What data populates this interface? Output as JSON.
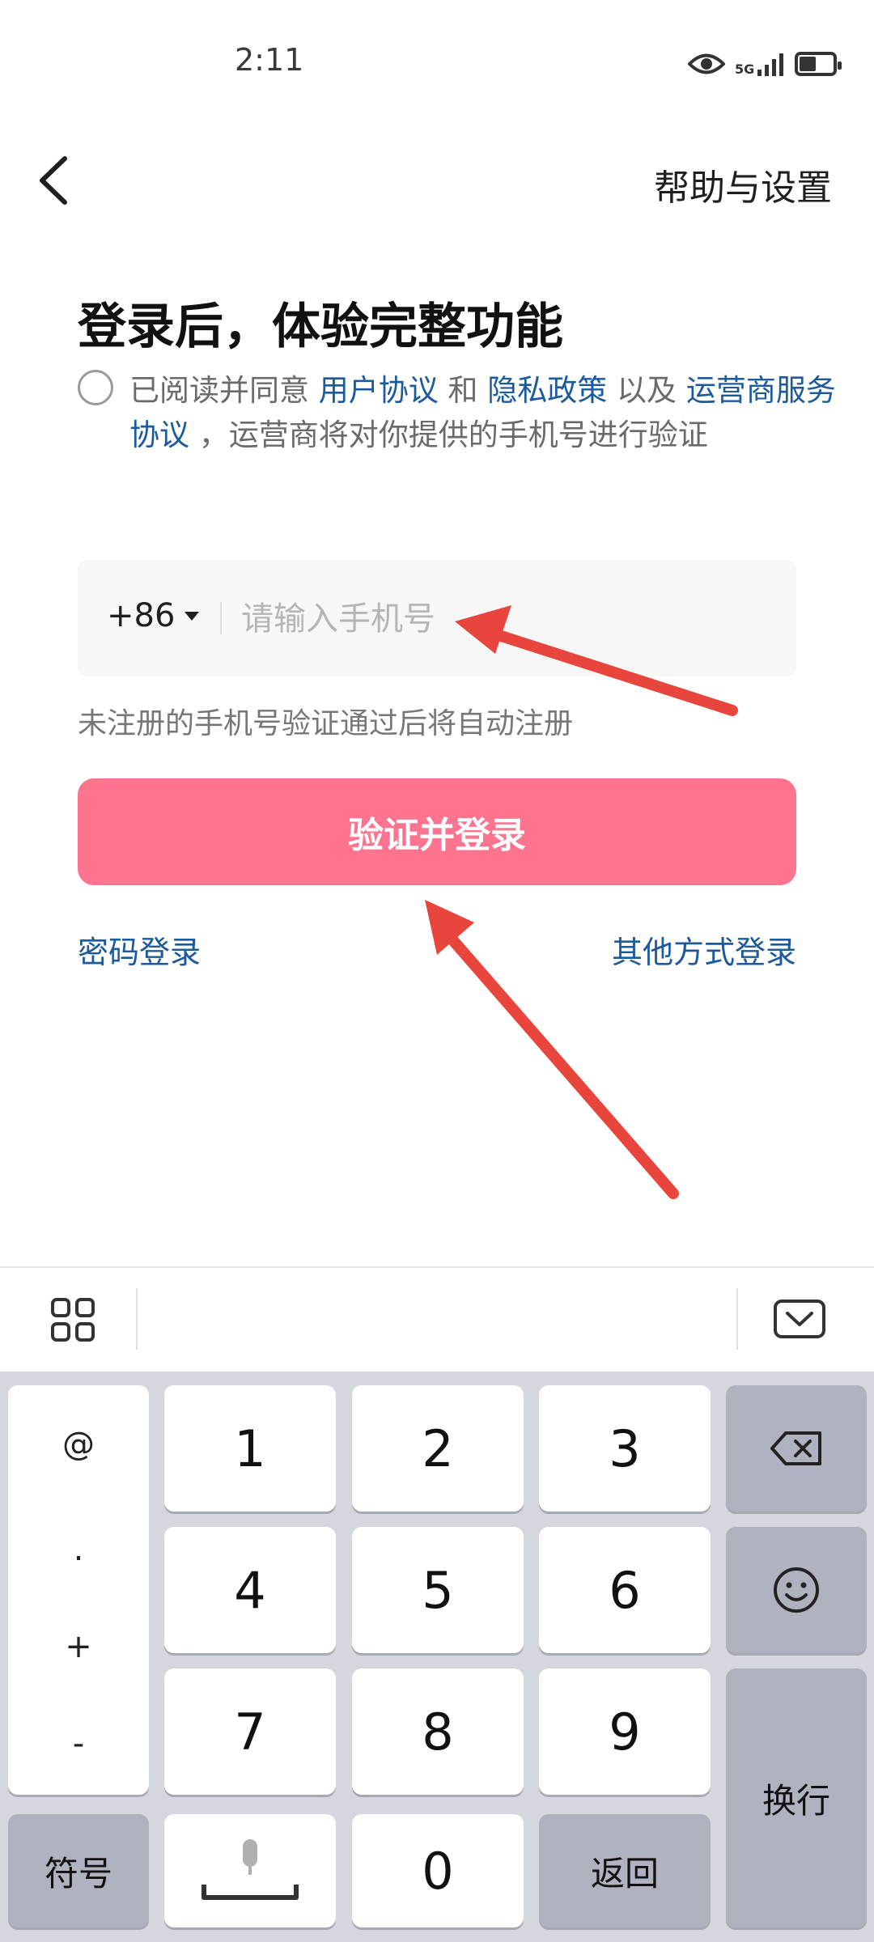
{
  "status_bar": {
    "time": "2:11",
    "network": "5G",
    "icons": [
      "eye-icon",
      "signal-icon",
      "battery-icon"
    ],
    "battery_level": 0.5
  },
  "header": {
    "help_label": "帮助与设置"
  },
  "main": {
    "title": "登录后，体验完整功能",
    "agreement": {
      "prefix": "已阅读并同意 ",
      "user_agreement": "用户协议",
      "and": " 和 ",
      "privacy_policy": "隐私政策",
      "also": " 以及 ",
      "carrier_agreement": "运营商服务协议",
      "suffix": " ，运营商将对你提供的手机号进行验证"
    },
    "phone": {
      "country_code": "+86",
      "placeholder": "请输入手机号"
    },
    "hint": "未注册的手机号验证通过后将自动注册",
    "login_button": "验证并登录",
    "password_login": "密码登录",
    "other_login": "其他方式登录"
  },
  "keyboard": {
    "left_symbols": [
      "@",
      ".",
      "+",
      "-"
    ],
    "digits": [
      "1",
      "2",
      "3",
      "4",
      "5",
      "6",
      "7",
      "8",
      "9",
      "0"
    ],
    "symbols_key": "符号",
    "return_key": "返回",
    "newline_key": "换行"
  },
  "colors": {
    "accent": "#fe738e",
    "link": "#1b5a9c",
    "annotation_arrow": "#e8453c"
  }
}
